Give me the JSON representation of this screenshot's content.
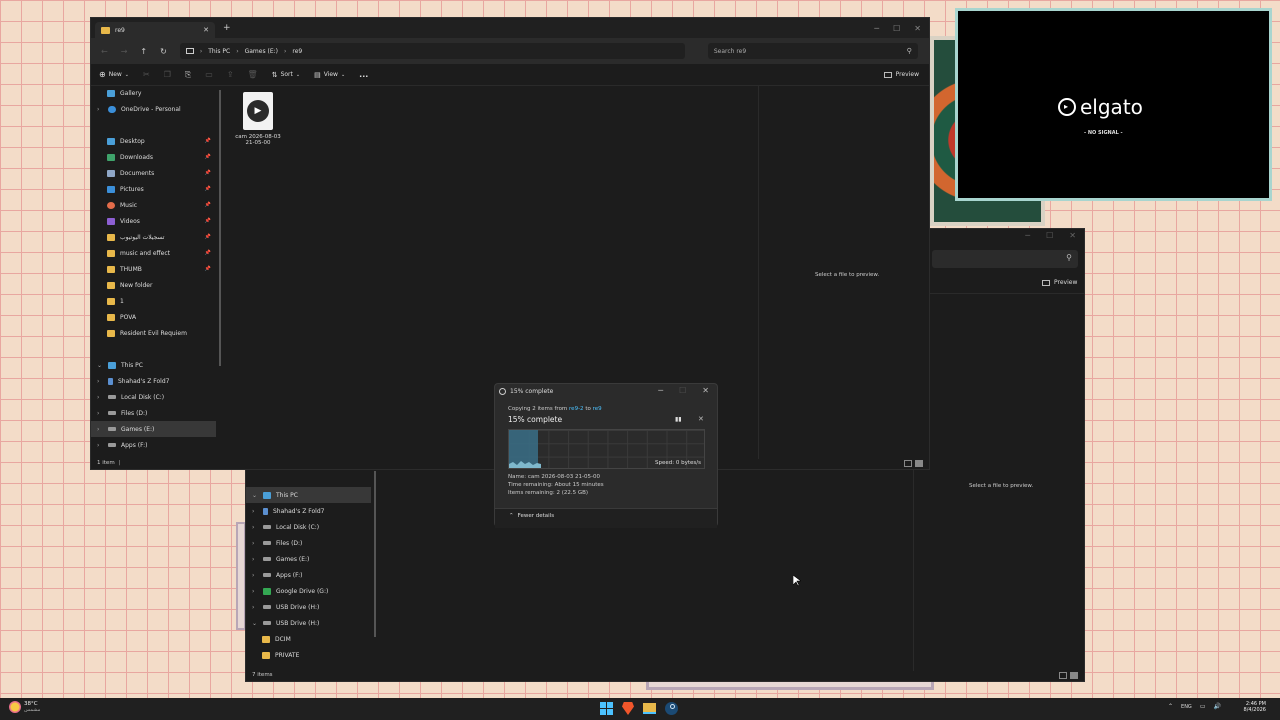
{
  "window_back": {
    "preview_label": "Preview",
    "preview_msg": "Select a file to preview.",
    "status": "7 items",
    "nav": [
      {
        "label": "This PC",
        "icon": "pc-icon",
        "selected": true,
        "expanded": true
      },
      {
        "label": "Shahad's Z Fold7",
        "icon": "phone-icon"
      },
      {
        "label": "Local Disk (C:)",
        "icon": "drive-icon"
      },
      {
        "label": "Files (D:)",
        "icon": "drive-icon"
      },
      {
        "label": "Games (E:)",
        "icon": "drive-icon"
      },
      {
        "label": "Apps (F:)",
        "icon": "drive-icon"
      },
      {
        "label": "Google Drive (G:)",
        "icon": "gdrive-icon"
      },
      {
        "label": "USB Drive (H:)",
        "icon": "usb-icon"
      },
      {
        "label": "USB Drive (H:)",
        "icon": "usb-icon",
        "expanded": true
      },
      {
        "label": "DCIM",
        "icon": "folder-icon"
      },
      {
        "label": "PRIVATE",
        "icon": "folder-icon"
      }
    ]
  },
  "window_front": {
    "tab_title": "re9",
    "breadcrumb": [
      "This PC",
      "Games (E:)",
      "re9"
    ],
    "search_placeholder": "Search re9",
    "toolbar": {
      "new": "New",
      "sort": "Sort",
      "view": "View",
      "more": "...",
      "preview": "Preview"
    },
    "nav": [
      {
        "label": "Gallery",
        "icon": "gallery-icon"
      },
      {
        "label": "OneDrive - Personal",
        "icon": "cloud-icon",
        "expandable": true
      },
      {
        "label": "Desktop",
        "icon": "desktop-icon",
        "pinned": true
      },
      {
        "label": "Downloads",
        "icon": "download-icon",
        "pinned": true
      },
      {
        "label": "Documents",
        "icon": "document-icon",
        "pinned": true
      },
      {
        "label": "Pictures",
        "icon": "picture-icon",
        "pinned": true
      },
      {
        "label": "Music",
        "icon": "music-icon",
        "pinned": true
      },
      {
        "label": "Videos",
        "icon": "video-icon",
        "pinned": true
      },
      {
        "label": "تسجيلات اليوتيوب",
        "icon": "folder-icon",
        "pinned": true
      },
      {
        "label": "music and effect",
        "icon": "folder-icon",
        "pinned": true
      },
      {
        "label": "THUMB",
        "icon": "folder-icon",
        "pinned": true
      },
      {
        "label": "New folder",
        "icon": "folder-icon"
      },
      {
        "label": "1",
        "icon": "folder-icon"
      },
      {
        "label": "POVA",
        "icon": "folder-icon"
      },
      {
        "label": "Resident Evil Requiem",
        "icon": "folder-icon"
      },
      {
        "label": "This PC",
        "icon": "pc-icon",
        "expanded": true
      },
      {
        "label": "Shahad's Z Fold7",
        "icon": "phone-icon"
      },
      {
        "label": "Local Disk (C:)",
        "icon": "drive-icon"
      },
      {
        "label": "Files (D:)",
        "icon": "drive-icon"
      },
      {
        "label": "Games (E:)",
        "icon": "drive-icon",
        "selected": true
      },
      {
        "label": "Apps (F:)",
        "icon": "drive-icon"
      }
    ],
    "file": {
      "name_line1": "cam 2026-08-03",
      "name_line2": "21-05-00"
    },
    "preview_msg": "Select a file to preview.",
    "status": "1 item"
  },
  "copy_dialog": {
    "title": "15% complete",
    "copying_prefix": "Copying 2 items from",
    "source": "re9-2",
    "to": "to",
    "dest": "re9",
    "heading": "15% complete",
    "progress": 0.15,
    "speed": "Speed: 0 bytes/s",
    "name_line": "Name:  cam 2026-08-03 21-05-00",
    "time_line": "Time remaining:  About 15 minutes",
    "items_line": "Items remaining:  2 (22.5 GB)",
    "fewer_details": "Fewer details"
  },
  "capture": {
    "brand": "elgato",
    "status": "- NO SIGNAL -"
  },
  "taskbar": {
    "weather_temp": "38°C",
    "weather_desc": "مشمس",
    "lang": "ENG",
    "time": "2:46 PM",
    "date": "8/4/2026"
  },
  "colors": {
    "accent": "#4cc2ff",
    "folder": "#e8b84a",
    "progress_fill": "#3a6f87"
  }
}
